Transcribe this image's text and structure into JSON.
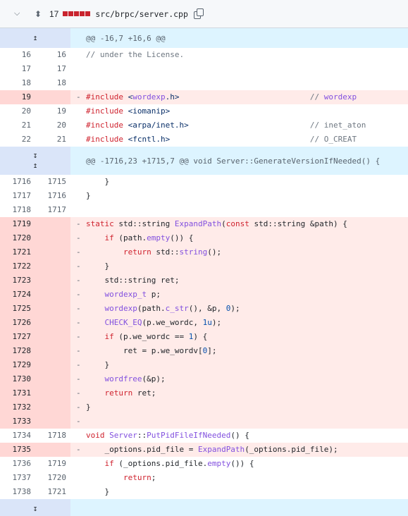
{
  "file": {
    "change_count": "17",
    "change_blocks": 5,
    "path": "src/brpc/server.cpp"
  },
  "hunks": {
    "h1": "@@ -16,7 +16,6 @@",
    "h2": "@@ -1716,23 +1715,7 @@ void Server::GenerateVersionIfNeeded() {"
  },
  "icons": {
    "expand": "chevron-down-icon",
    "expand_all": "unfold-icon",
    "copy": "copy-icon",
    "expand_up": "expand-up-icon",
    "expand_down": "expand-down-icon"
  },
  "colors": {
    "deletion_line": "#ffebe9",
    "deletion_num": "#ffd7d5",
    "hunk_bg": "#ddf4ff",
    "hunk_expander": "#dae5f9",
    "deletion_blocks": "#c9242e"
  },
  "lines": [
    {
      "old": "16",
      "new": "16",
      "sign": " ",
      "code": "// under the License."
    },
    {
      "old": "17",
      "new": "17",
      "sign": " ",
      "code": ""
    },
    {
      "old": "18",
      "new": "18",
      "sign": " ",
      "code": ""
    },
    {
      "old": "19",
      "new": "",
      "sign": "-",
      "code": "#include <wordexp.h>                            // wordexp"
    },
    {
      "old": "20",
      "new": "19",
      "sign": " ",
      "code": "#include <iomanip>"
    },
    {
      "old": "21",
      "new": "20",
      "sign": " ",
      "code": "#include <arpa/inet.h>                          // inet_aton"
    },
    {
      "old": "22",
      "new": "21",
      "sign": " ",
      "code": "#include <fcntl.h>                              // O_CREAT"
    },
    {
      "old": "1716",
      "new": "1715",
      "sign": " ",
      "code": "    }"
    },
    {
      "old": "1717",
      "new": "1716",
      "sign": " ",
      "code": "}"
    },
    {
      "old": "1718",
      "new": "1717",
      "sign": " ",
      "code": ""
    },
    {
      "old": "1719",
      "new": "",
      "sign": "-",
      "code": "static std::string ExpandPath(const std::string &path) {"
    },
    {
      "old": "1720",
      "new": "",
      "sign": "-",
      "code": "    if (path.empty()) {"
    },
    {
      "old": "1721",
      "new": "",
      "sign": "-",
      "code": "        return std::string();"
    },
    {
      "old": "1722",
      "new": "",
      "sign": "-",
      "code": "    }"
    },
    {
      "old": "1723",
      "new": "",
      "sign": "-",
      "code": "    std::string ret;"
    },
    {
      "old": "1724",
      "new": "",
      "sign": "-",
      "code": "    wordexp_t p;"
    },
    {
      "old": "1725",
      "new": "",
      "sign": "-",
      "code": "    wordexp(path.c_str(), &p, 0);"
    },
    {
      "old": "1726",
      "new": "",
      "sign": "-",
      "code": "    CHECK_EQ(p.we_wordc, 1u);"
    },
    {
      "old": "1727",
      "new": "",
      "sign": "-",
      "code": "    if (p.we_wordc == 1) {"
    },
    {
      "old": "1728",
      "new": "",
      "sign": "-",
      "code": "        ret = p.we_wordv[0];"
    },
    {
      "old": "1729",
      "new": "",
      "sign": "-",
      "code": "    }"
    },
    {
      "old": "1730",
      "new": "",
      "sign": "-",
      "code": "    wordfree(&p);"
    },
    {
      "old": "1731",
      "new": "",
      "sign": "-",
      "code": "    return ret;"
    },
    {
      "old": "1732",
      "new": "",
      "sign": "-",
      "code": "}"
    },
    {
      "old": "1733",
      "new": "",
      "sign": "-",
      "code": ""
    },
    {
      "old": "1734",
      "new": "1718",
      "sign": " ",
      "code": "void Server::PutPidFileIfNeeded() {"
    },
    {
      "old": "1735",
      "new": "",
      "sign": "-",
      "code": "    _options.pid_file = ExpandPath(_options.pid_file);"
    },
    {
      "old": "1736",
      "new": "1719",
      "sign": " ",
      "code": "    if (_options.pid_file.empty()) {"
    },
    {
      "old": "1737",
      "new": "1720",
      "sign": " ",
      "code": "        return;"
    },
    {
      "old": "1738",
      "new": "1721",
      "sign": " ",
      "code": "    }"
    }
  ]
}
